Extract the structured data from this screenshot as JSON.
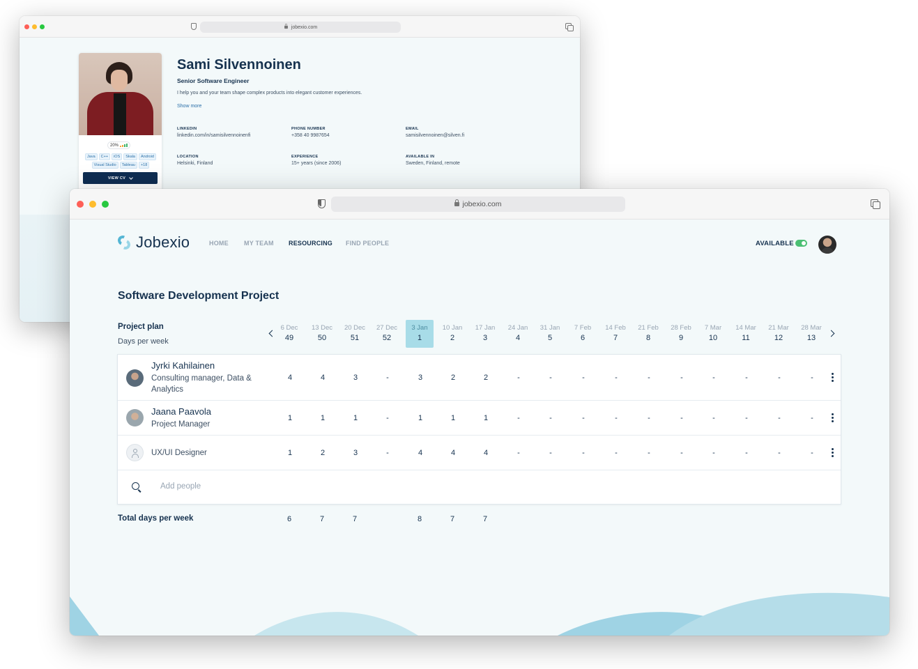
{
  "back_window": {
    "url": "jobexio.com",
    "profile": {
      "name": "Sami Silvennoinen",
      "role": "Senior Software Engineer",
      "bio": "I help you and your team shape complex products into elegant customer experiences.",
      "show_more": "Show more",
      "match_percent": "20%",
      "skills": [
        "Java",
        "C++",
        "iOS",
        "Skala",
        "Android",
        "Visual Studio",
        "Tableau",
        "+18"
      ],
      "view_cv": "VIEW CV",
      "fields": {
        "linkedin": {
          "label": "LINKEDIN",
          "value": "linkedin.com/in/samisilvennoinenfi"
        },
        "phone": {
          "label": "PHONE NUMBER",
          "value": "+358 40 9987654"
        },
        "email": {
          "label": "EMAIL",
          "value": "samisilvennoinen@silven.fi"
        },
        "location": {
          "label": "LOCATION",
          "value": "Helsinki, Finland"
        },
        "experience": {
          "label": "EXPERIENCE",
          "value": "15+ years (since 2006)"
        },
        "available_in": {
          "label": "AVAILABLE IN",
          "value": "Sweden, Finland, remote"
        }
      }
    }
  },
  "front_window": {
    "url": "jobexio.com",
    "logo": "Jobexio",
    "nav": {
      "home": "HOME",
      "my_team": "MY TEAM",
      "resourcing": "RESOURCING",
      "find_people": "FIND PEOPLE",
      "available": "AVAILABLE",
      "available_on": true
    },
    "project_title": "Software Development Project",
    "plan_label": "Project plan",
    "plan_sub": "Days per week",
    "weeks": [
      {
        "date": "6 Dec",
        "num": "49"
      },
      {
        "date": "13 Dec",
        "num": "50"
      },
      {
        "date": "20 Dec",
        "num": "51"
      },
      {
        "date": "27 Dec",
        "num": "52"
      },
      {
        "date": "3 Jan",
        "num": "1",
        "current": true
      },
      {
        "date": "10 Jan",
        "num": "2"
      },
      {
        "date": "17 Jan",
        "num": "3"
      },
      {
        "date": "24 Jan",
        "num": "4"
      },
      {
        "date": "31 Jan",
        "num": "5"
      },
      {
        "date": "7 Feb",
        "num": "6"
      },
      {
        "date": "14 Feb",
        "num": "7"
      },
      {
        "date": "21 Feb",
        "num": "8"
      },
      {
        "date": "28 Feb",
        "num": "9"
      },
      {
        "date": "7 Mar",
        "num": "10"
      },
      {
        "date": "14 Mar",
        "num": "11"
      },
      {
        "date": "21 Mar",
        "num": "12"
      },
      {
        "date": "28 Mar",
        "num": "13"
      }
    ],
    "rows": [
      {
        "name": "Jyrki Kahilainen",
        "role": "Consulting manager, Data & Analytics",
        "values": [
          "4",
          "4",
          "3",
          "-",
          "3",
          "2",
          "2",
          "-",
          "-",
          "-",
          "-",
          "-",
          "-",
          "-",
          "-",
          "-",
          "-"
        ]
      },
      {
        "name": "Jaana Paavola",
        "role": "Project Manager",
        "values": [
          "1",
          "1",
          "1",
          "-",
          "1",
          "1",
          "1",
          "-",
          "-",
          "-",
          "-",
          "-",
          "-",
          "-",
          "-",
          "-",
          "-"
        ]
      },
      {
        "name": "",
        "role": "UX/UI Designer",
        "values": [
          "1",
          "2",
          "3",
          "-",
          "4",
          "4",
          "4",
          "-",
          "-",
          "-",
          "-",
          "-",
          "-",
          "-",
          "-",
          "-",
          "-"
        ]
      }
    ],
    "add_people_placeholder": "Add people",
    "total_label": "Total days per week",
    "totals": [
      "6",
      "7",
      "7",
      "",
      "8",
      "7",
      "7"
    ]
  }
}
